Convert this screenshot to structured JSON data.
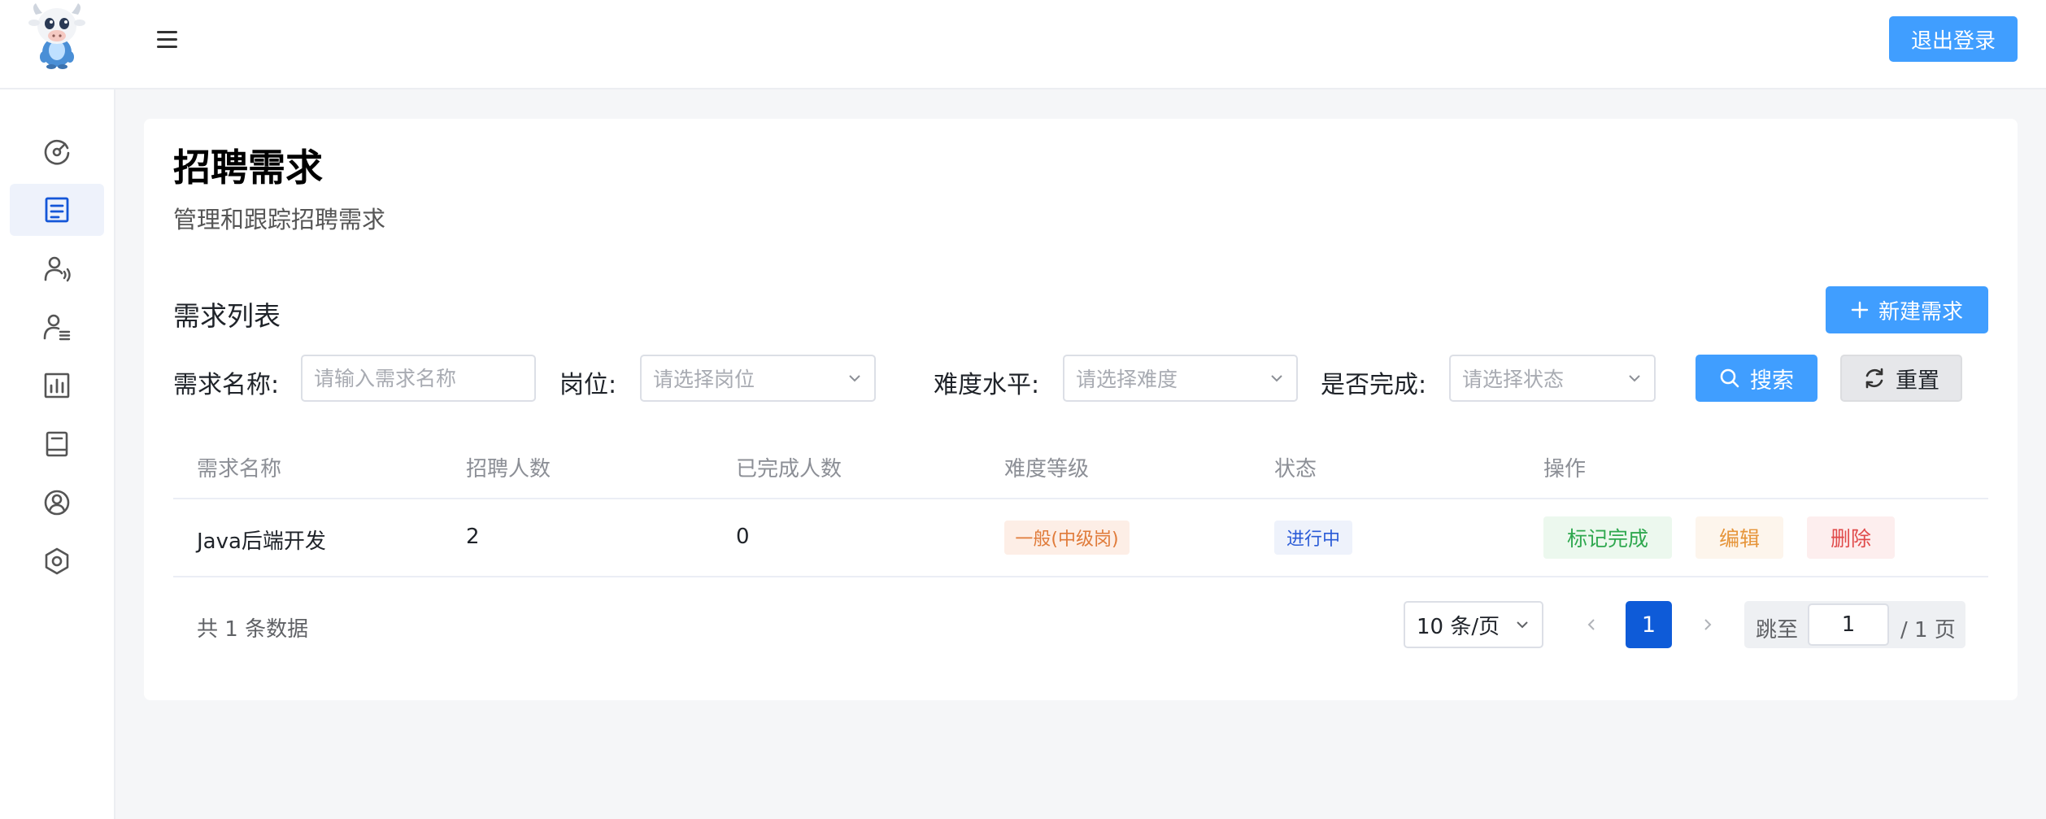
{
  "header": {
    "logout_label": "退出登录"
  },
  "sidebar": {
    "items": [
      {
        "icon": "dashboard-gauge-icon",
        "active": false
      },
      {
        "icon": "document-list-icon",
        "active": true
      },
      {
        "icon": "user-voice-icon",
        "active": false
      },
      {
        "icon": "user-list-icon",
        "active": false
      },
      {
        "icon": "bar-chart-icon",
        "active": false
      },
      {
        "icon": "book-icon",
        "active": false
      },
      {
        "icon": "user-circle-icon",
        "active": false
      },
      {
        "icon": "settings-hexagon-icon",
        "active": false
      }
    ]
  },
  "page": {
    "title": "招聘需求",
    "subtitle": "管理和跟踪招聘需求",
    "section_title": "需求列表",
    "new_button_label": "新建需求"
  },
  "filters": {
    "name_label": "需求名称:",
    "name_placeholder": "请输入需求名称",
    "position_label": "岗位:",
    "position_placeholder": "请选择岗位",
    "difficulty_label": "难度水平:",
    "difficulty_placeholder": "请选择难度",
    "status_label": "是否完成:",
    "status_placeholder": "请选择状态",
    "search_label": "搜索",
    "reset_label": "重置"
  },
  "table": {
    "columns": [
      "需求名称",
      "招聘人数",
      "已完成人数",
      "难度等级",
      "状态",
      "操作"
    ],
    "rows": [
      {
        "name": "Java后端开发",
        "count": "2",
        "completed": "0",
        "difficulty": "一般(中级岗)",
        "status": "进行中",
        "actions": {
          "complete": "标记完成",
          "edit": "编辑",
          "delete": "删除"
        }
      }
    ]
  },
  "pagination": {
    "total_text": "共 1 条数据",
    "page_size": "10 条/页",
    "current_page": "1",
    "jump_label": "跳至",
    "jump_value": "1",
    "jump_suffix": "/ 1 页"
  },
  "colors": {
    "primary": "#409eff",
    "active_page": "#0e5bd8",
    "tag_difficulty_bg": "#fdeee6",
    "tag_difficulty_text": "#e07b3a",
    "tag_status_bg": "#eef2fb",
    "tag_status_text": "#2a5bd7",
    "complete_bg": "#ecf8ee",
    "complete_text": "#2fa84f",
    "edit_bg": "#fdf5ec",
    "edit_text": "#e6953a",
    "delete_bg": "#fdeeee",
    "delete_text": "#e04a4a"
  }
}
